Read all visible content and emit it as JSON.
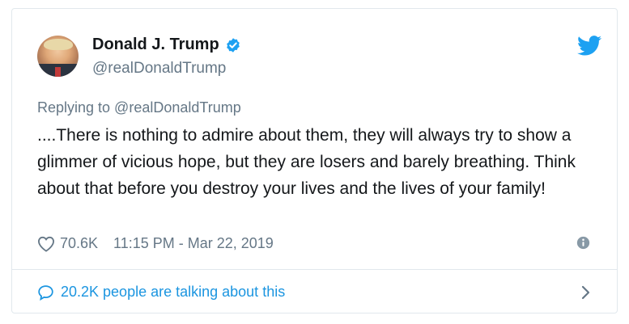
{
  "author": {
    "name": "Donald J. Trump",
    "handle": "@realDonaldTrump",
    "verified": true
  },
  "reply": {
    "label": "Replying to @realDonaldTrump"
  },
  "tweet": {
    "text": "....There is nothing to admire about them, they will always try to show a glimmer of vicious hope, but they are losers and barely breathing. Think about that before you destroy your lives and the lives of your family!"
  },
  "meta": {
    "likes": "70.6K",
    "timestamp": "11:15 PM - Mar 22, 2019"
  },
  "footer": {
    "label": "20.2K people are talking about this"
  },
  "icons": {
    "brand": "twitter-bird-icon",
    "verified": "verified-badge-icon",
    "like": "heart-icon",
    "info": "info-icon",
    "conversation": "speech-bubble-icon",
    "expand": "chevron-right-icon"
  },
  "colors": {
    "brand": "#1da1f2",
    "link": "#1b95e0",
    "text": "#14171a",
    "muted": "#657786",
    "border": "#e1e8ed"
  }
}
